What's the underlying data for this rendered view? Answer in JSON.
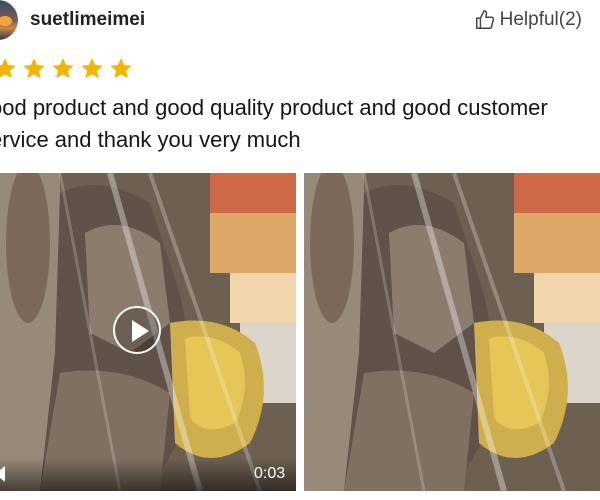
{
  "reviewer": {
    "username": "suetlimeimei"
  },
  "helpful": {
    "label": "Helpful(2)"
  },
  "rating": {
    "stars": 5,
    "color": "#f5b400"
  },
  "review": {
    "text": "ood product and good quality product and good customer\nervice and thank you very much"
  },
  "media": {
    "video": {
      "duration": "0:03"
    }
  }
}
